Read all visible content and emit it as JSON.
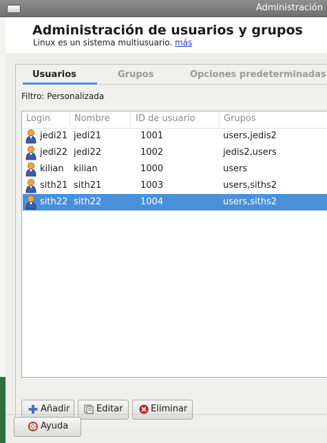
{
  "window": {
    "title": "Administración"
  },
  "header": {
    "title": "Administración de usuarios y grupos",
    "subtitle": "Linux es un sistema multiusuario.",
    "more_link": "más"
  },
  "tabs": [
    {
      "label": "Usuarios",
      "active": true
    },
    {
      "label": "Grupos",
      "active": false
    },
    {
      "label": "Opciones predeterminadas",
      "active": false
    }
  ],
  "filter": {
    "text": "Filtro: Personalizada"
  },
  "table": {
    "columns": [
      "Login",
      "Nombre",
      "ID de usuario",
      "Grupos"
    ],
    "rows": [
      {
        "login": "jedi21",
        "name": "jedi21",
        "uid": "1001",
        "groups": "users,jedis2",
        "selected": false
      },
      {
        "login": "jedi22",
        "name": "jedi22",
        "uid": "1002",
        "groups": "jedis2,users",
        "selected": false
      },
      {
        "login": "kilian",
        "name": "kilian",
        "uid": "1000",
        "groups": "users",
        "selected": false
      },
      {
        "login": "sith21",
        "name": "sith21",
        "uid": "1003",
        "groups": "users,siths2",
        "selected": false
      },
      {
        "login": "sith22",
        "name": "sith22",
        "uid": "1004",
        "groups": "users,siths2",
        "selected": true
      }
    ]
  },
  "actions": {
    "add": "Añadir",
    "edit": "Editar",
    "delete": "Eliminar"
  },
  "footer": {
    "help": "Ayuda"
  },
  "colors": {
    "selection": "#4a90d9",
    "tab_accent": "#4a90d9",
    "link": "#1f3fbf"
  },
  "icons": {
    "user": "user-icon",
    "add": "plus-icon",
    "edit": "edit-icon",
    "delete": "delete-icon",
    "help": "help-icon"
  }
}
